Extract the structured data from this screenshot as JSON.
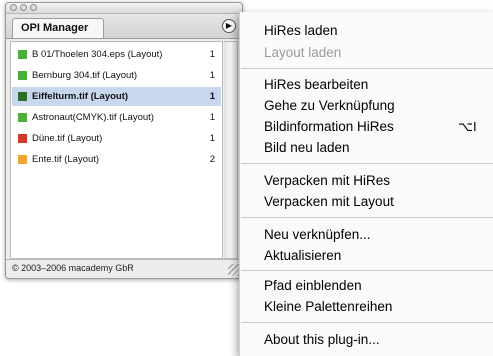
{
  "palette": {
    "tab_label": "OPI Manager",
    "menu_button_glyph": "▶",
    "items": [
      {
        "name": "B 01/Thoelen 304.eps (Layout)",
        "count": "1",
        "color": "#4caf3a",
        "selected": false
      },
      {
        "name": "Bernburg 304.tif (Layout)",
        "count": "1",
        "color": "#4caf3a",
        "selected": false
      },
      {
        "name": "Eiffelturm.tif (Layout)",
        "count": "1",
        "color": "#2d6e2a",
        "selected": true
      },
      {
        "name": "Astronaut(CMYK).tif (Layout)",
        "count": "1",
        "color": "#4caf3a",
        "selected": false
      },
      {
        "name": "Düne.tif (Layout)",
        "count": "1",
        "color": "#d03a2a",
        "selected": false
      },
      {
        "name": "Ente.tif (Layout)",
        "count": "2",
        "color": "#f0a531",
        "selected": false
      }
    ],
    "footer": "© 2003–2006 macademy GbR"
  },
  "menu": {
    "items": [
      {
        "label": "HiRes laden",
        "disabled": false
      },
      {
        "label": "Layout laden",
        "disabled": true
      },
      {
        "label": "HiRes bearbeiten",
        "disabled": false
      },
      {
        "label": "Gehe zu Verknüpfung",
        "disabled": false
      },
      {
        "label": "Bildinformation HiRes",
        "disabled": false,
        "shortcut": "⌥I"
      },
      {
        "label": "Bild neu laden",
        "disabled": false
      },
      {
        "label": "Verpacken mit HiRes",
        "disabled": false
      },
      {
        "label": "Verpacken mit Layout",
        "disabled": false
      },
      {
        "label": "Neu verknüpfen...",
        "disabled": false
      },
      {
        "label": "Aktualisieren",
        "disabled": false
      },
      {
        "label": "Pfad einblenden",
        "disabled": false
      },
      {
        "label": "Kleine Palettenreihen",
        "disabled": false
      },
      {
        "label": "About this plug-in...",
        "disabled": false
      }
    ]
  }
}
